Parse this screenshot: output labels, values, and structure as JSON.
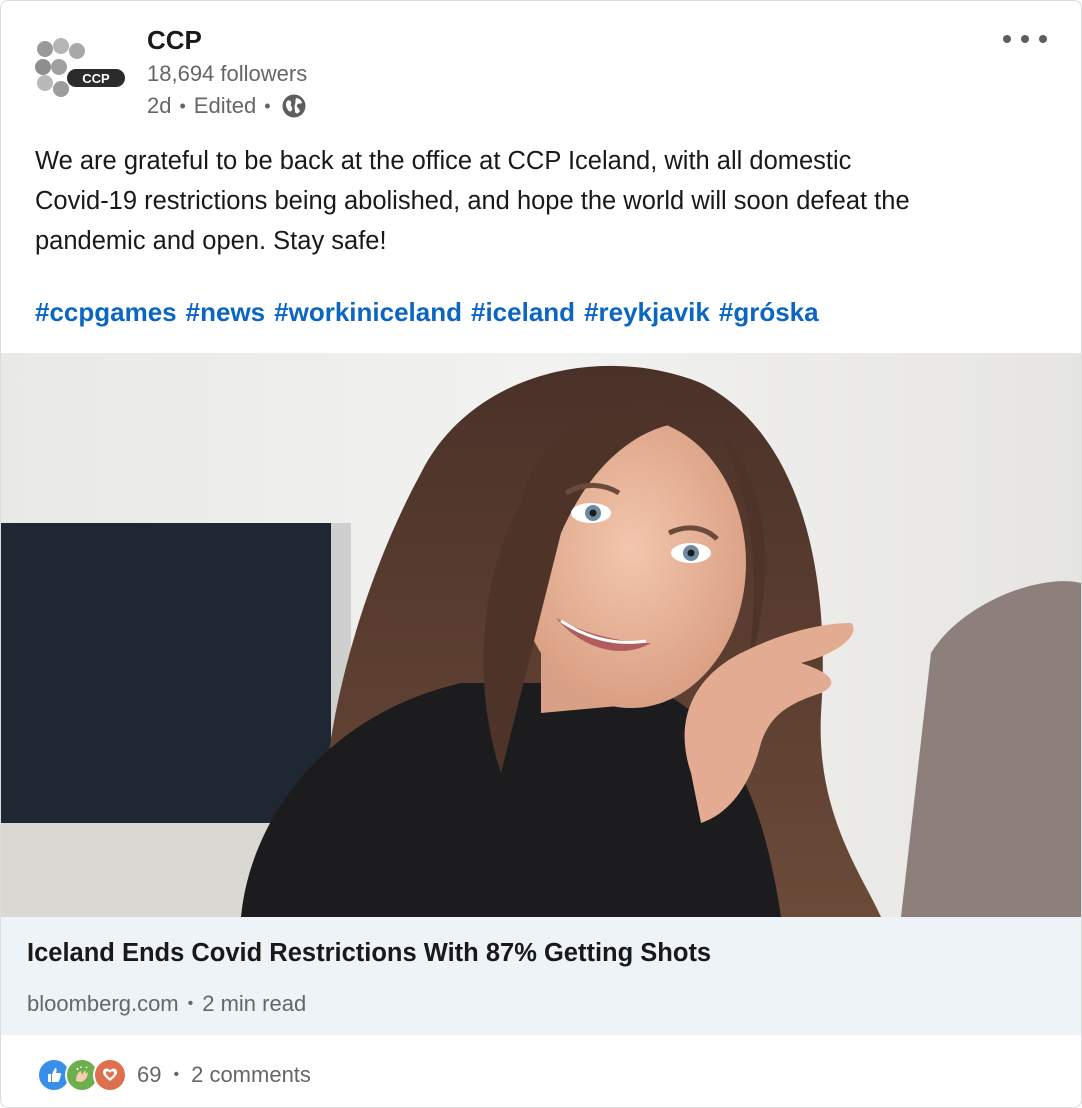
{
  "post": {
    "author": {
      "name": "CCP",
      "followers": "18,694 followers",
      "time": "2d",
      "edited": "Edited",
      "logo_text": "CCP",
      "visibility_icon": "globe-icon"
    },
    "menu_icon": "more-horizontal-icon",
    "text_lines": [
      "We are grateful to be back at the office at CCP Iceland, with all domestic",
      "Covid-19 restrictions being abolished, and hope the world will soon defeat the",
      "pandemic and open. Stay safe!"
    ],
    "hashtags": [
      "#ccpgames",
      "#news",
      "#workiniceland",
      "#iceland",
      "#reykjavik",
      "#gróska"
    ],
    "article": {
      "title": "Iceland Ends Covid Restrictions With 87% Getting Shots",
      "source": "bloomberg.com",
      "read_time": "2 min read"
    },
    "social": {
      "reaction_icons": [
        "like-icon",
        "celebrate-icon",
        "love-icon"
      ],
      "reaction_count": "69",
      "comments": "2 comments"
    }
  },
  "colors": {
    "link": "#0a66c2",
    "article_bg": "#eef3f8",
    "secondary_text": "#666666"
  }
}
